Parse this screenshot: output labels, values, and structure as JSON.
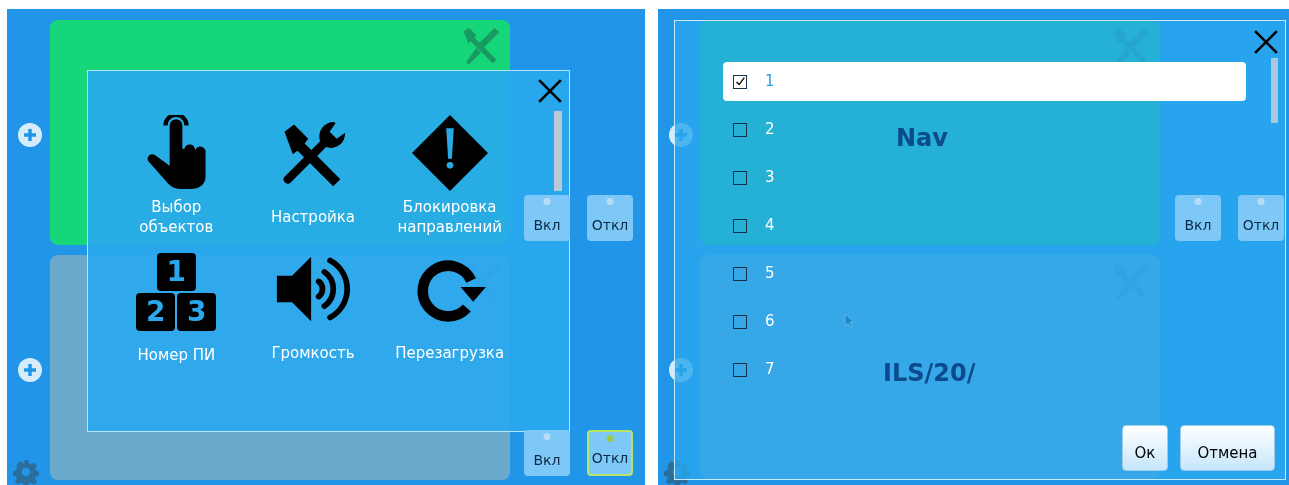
{
  "left_screen": {
    "panels": [
      {
        "active": true,
        "buttons": [
          {
            "label": "Вкл",
            "selected": false
          },
          {
            "label": "Откл",
            "selected": false
          }
        ]
      },
      {
        "active": false,
        "buttons": [
          {
            "label": "Вкл",
            "selected": false
          },
          {
            "label": "Откл",
            "selected": true
          }
        ]
      }
    ],
    "menu": {
      "items": [
        {
          "label": "Выбор\nобъектов"
        },
        {
          "label": "Настройка"
        },
        {
          "label": "Блокировка\nнаправлений"
        },
        {
          "label": "Номер ПИ",
          "glyphs": [
            "1",
            "2",
            "3"
          ]
        },
        {
          "label": "Громкость"
        },
        {
          "label": "Перезагрузка"
        }
      ]
    }
  },
  "right_screen": {
    "panels": [
      {
        "label": "Nav",
        "active": true,
        "buttons": [
          {
            "label": "Вкл",
            "selected": false
          },
          {
            "label": "Откл",
            "selected": false
          }
        ]
      },
      {
        "label": "ILS/20/",
        "active": false
      }
    ],
    "dialog": {
      "items": [
        {
          "label": "1",
          "checked": true,
          "selected": true
        },
        {
          "label": "2",
          "checked": false,
          "selected": false
        },
        {
          "label": "3",
          "checked": false,
          "selected": false
        },
        {
          "label": "4",
          "checked": false,
          "selected": false
        },
        {
          "label": "5",
          "checked": false,
          "selected": false
        },
        {
          "label": "6",
          "checked": false,
          "selected": false
        },
        {
          "label": "7",
          "checked": false,
          "selected": false
        }
      ],
      "buttons": [
        "Ок",
        "Отмена"
      ]
    }
  }
}
